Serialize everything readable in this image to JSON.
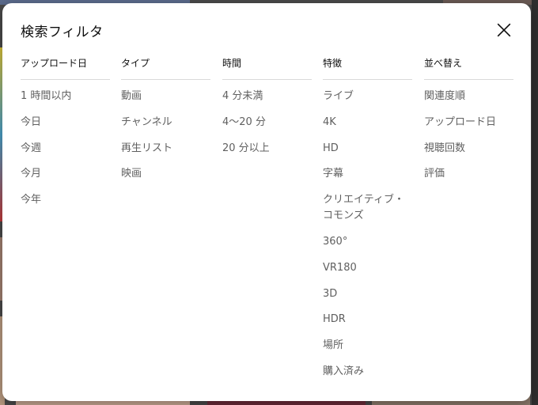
{
  "dialog": {
    "title": "検索フィルタ",
    "close_icon": "close-icon"
  },
  "columns": [
    {
      "header": "アップロード日",
      "items": [
        "1 時間以内",
        "今日",
        "今週",
        "今月",
        "今年"
      ]
    },
    {
      "header": "タイプ",
      "items": [
        "動画",
        "チャンネル",
        "再生リスト",
        "映画"
      ]
    },
    {
      "header": "時間",
      "items": [
        "4 分未満",
        "4～20 分",
        "20 分以上"
      ]
    },
    {
      "header": "特徴",
      "items": [
        "ライブ",
        "4K",
        "HD",
        "字幕",
        "クリエイティブ・\nコモンズ",
        "360°",
        "VR180",
        "3D",
        "HDR",
        "場所",
        "購入済み"
      ]
    },
    {
      "header": "並べ替え",
      "items": [
        "関連度順",
        "アップロード日",
        "視聴回数",
        "評価"
      ],
      "selected": "関連度順"
    }
  ],
  "colors": {
    "dialog_bg": "#ffffff",
    "text_primary": "#0f0f0f",
    "text_secondary": "#606060",
    "divider": "#d9d9d9"
  }
}
